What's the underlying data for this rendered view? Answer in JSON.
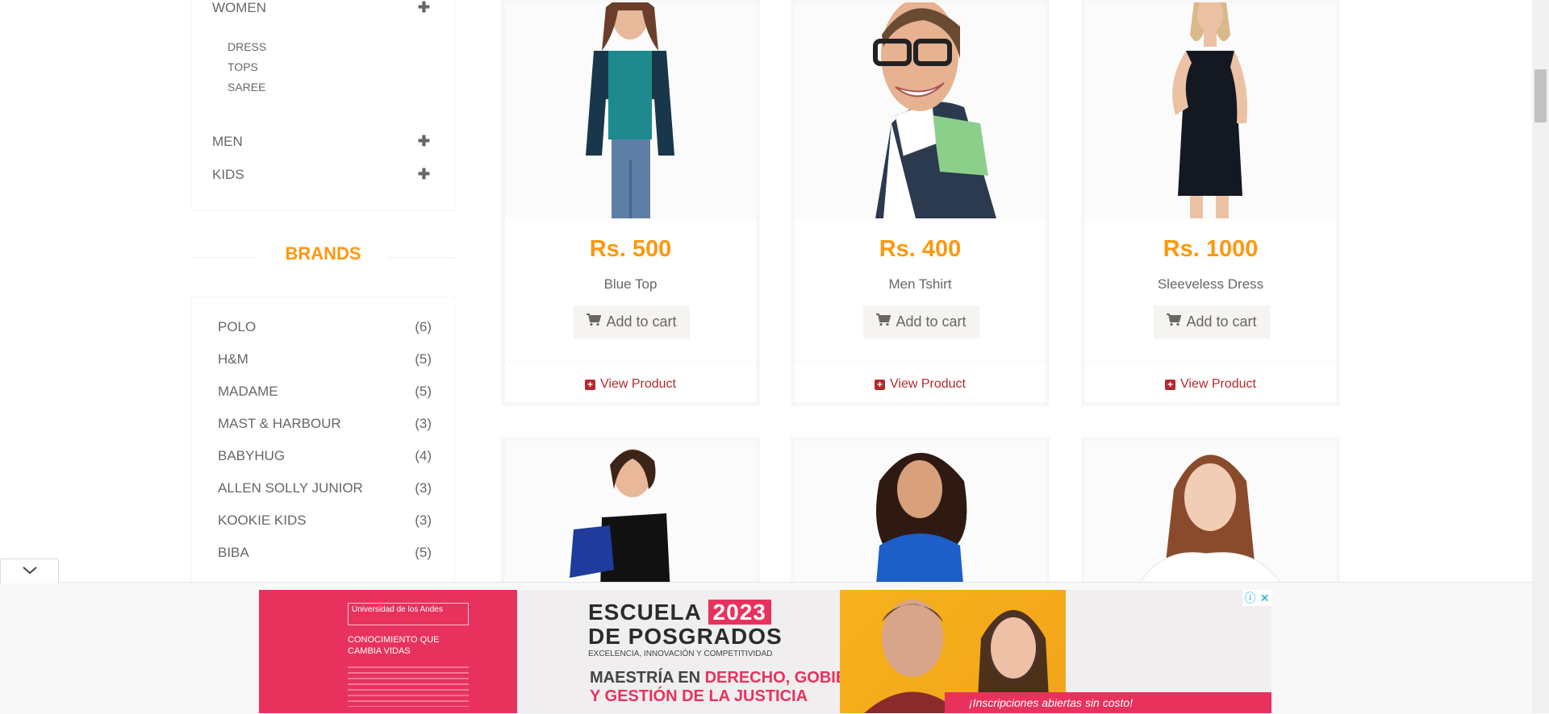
{
  "sidebar": {
    "categories": [
      {
        "label": "WOMEN",
        "expand_icon": "plus-icon"
      },
      {
        "label": "MEN",
        "expand_icon": "plus-icon"
      },
      {
        "label": "KIDS",
        "expand_icon": "plus-icon"
      }
    ],
    "women_subcategories": [
      "DRESS",
      "TOPS",
      "SAREE"
    ],
    "brands_title": "BRANDS",
    "brands": [
      {
        "name": "POLO",
        "count": "(6)"
      },
      {
        "name": "H&M",
        "count": "(5)"
      },
      {
        "name": "MADAME",
        "count": "(5)"
      },
      {
        "name": "MAST & HARBOUR",
        "count": "(3)"
      },
      {
        "name": "BABYHUG",
        "count": "(4)"
      },
      {
        "name": "ALLEN SOLLY JUNIOR",
        "count": "(3)"
      },
      {
        "name": "KOOKIE KIDS",
        "count": "(3)"
      },
      {
        "name": "BIBA",
        "count": "(5)"
      }
    ]
  },
  "products": [
    {
      "price": "Rs. 500",
      "name": "Blue Top",
      "cart_label": "Add to cart",
      "view_label": "View Product"
    },
    {
      "price": "Rs. 400",
      "name": "Men Tshirt",
      "cart_label": "Add to cart",
      "view_label": "View Product"
    },
    {
      "price": "Rs. 1000",
      "name": "Sleeveless Dress",
      "cart_label": "Add to cart",
      "view_label": "View Product"
    }
  ],
  "ad": {
    "school_line1": "ESCUELA",
    "year": "2023",
    "school_line2": "DE POSGRADOS",
    "tagline": "EXCELENCIA, INNOVACIÓN Y COMPETITIVIDAD",
    "program_line1_prefix": "MAESTRÍA EN ",
    "program_line1_highlight": "DERECHO, GOBIERNO",
    "program_line2": "Y GESTIÓN DE LA JUSTICIA",
    "cta": "¡Inscripciones abiertas sin costo!",
    "university": "Universidad de los Andes",
    "slogan": "CONOCIMIENTO QUE CAMBIA VIDAS"
  },
  "colors": {
    "accent": "#fe980f",
    "link": "#b4292e",
    "text": "#696763"
  }
}
